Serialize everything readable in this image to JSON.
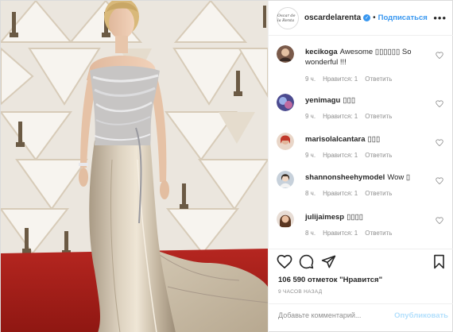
{
  "photo": {
    "description_icons": [
      "statuette-icon"
    ],
    "colors": {
      "backdrop": "#ebe6de",
      "carpet": "#b3221e",
      "gown": "#cdbfa9"
    }
  },
  "header": {
    "username": "oscardelarenta",
    "avatar_text": "Oscar de la Renta",
    "separator": "•",
    "follow_label": "Подписаться",
    "more_label": "•••"
  },
  "comments": [
    {
      "user": "kecikoga",
      "text": "Awesome ▯▯▯▯▯▯ So wonderful !!!",
      "time": "9 ч.",
      "likes": "Нравится: 1",
      "reply": "Ответить",
      "avatar_color": "#7a5a4a"
    },
    {
      "user": "yenimagu",
      "text": "▯▯▯",
      "time": "9 ч.",
      "likes": "Нравится: 1",
      "reply": "Ответить",
      "avatar_color": "#5a4a8a"
    },
    {
      "user": "marisolalcantara",
      "text": "▯▯▯",
      "time": "9 ч.",
      "likes": "Нравится: 1",
      "reply": "Ответить",
      "avatar_color": "#c0392b"
    },
    {
      "user": "shannonsheehymodel",
      "text": "Wow ▯",
      "time": "8 ч.",
      "likes": "Нравится: 1",
      "reply": "Ответить",
      "avatar_color": "#a8b8c8"
    },
    {
      "user": "julijaimesp",
      "text": "▯▯▯▯",
      "time": "8 ч.",
      "likes": "Нравится: 1",
      "reply": "Ответить",
      "avatar_color": "#8a5a3a"
    }
  ],
  "actions": {
    "likes_label": "106 590 отметок \"Нравится\"",
    "time_label": "9 часов назад",
    "comment_placeholder": "Добавьте комментарий...",
    "post_label": "Опубликовать",
    "colors": {
      "link": "#3897f0",
      "post_disabled": "#b2dffc",
      "muted": "#8e8e8e"
    }
  }
}
